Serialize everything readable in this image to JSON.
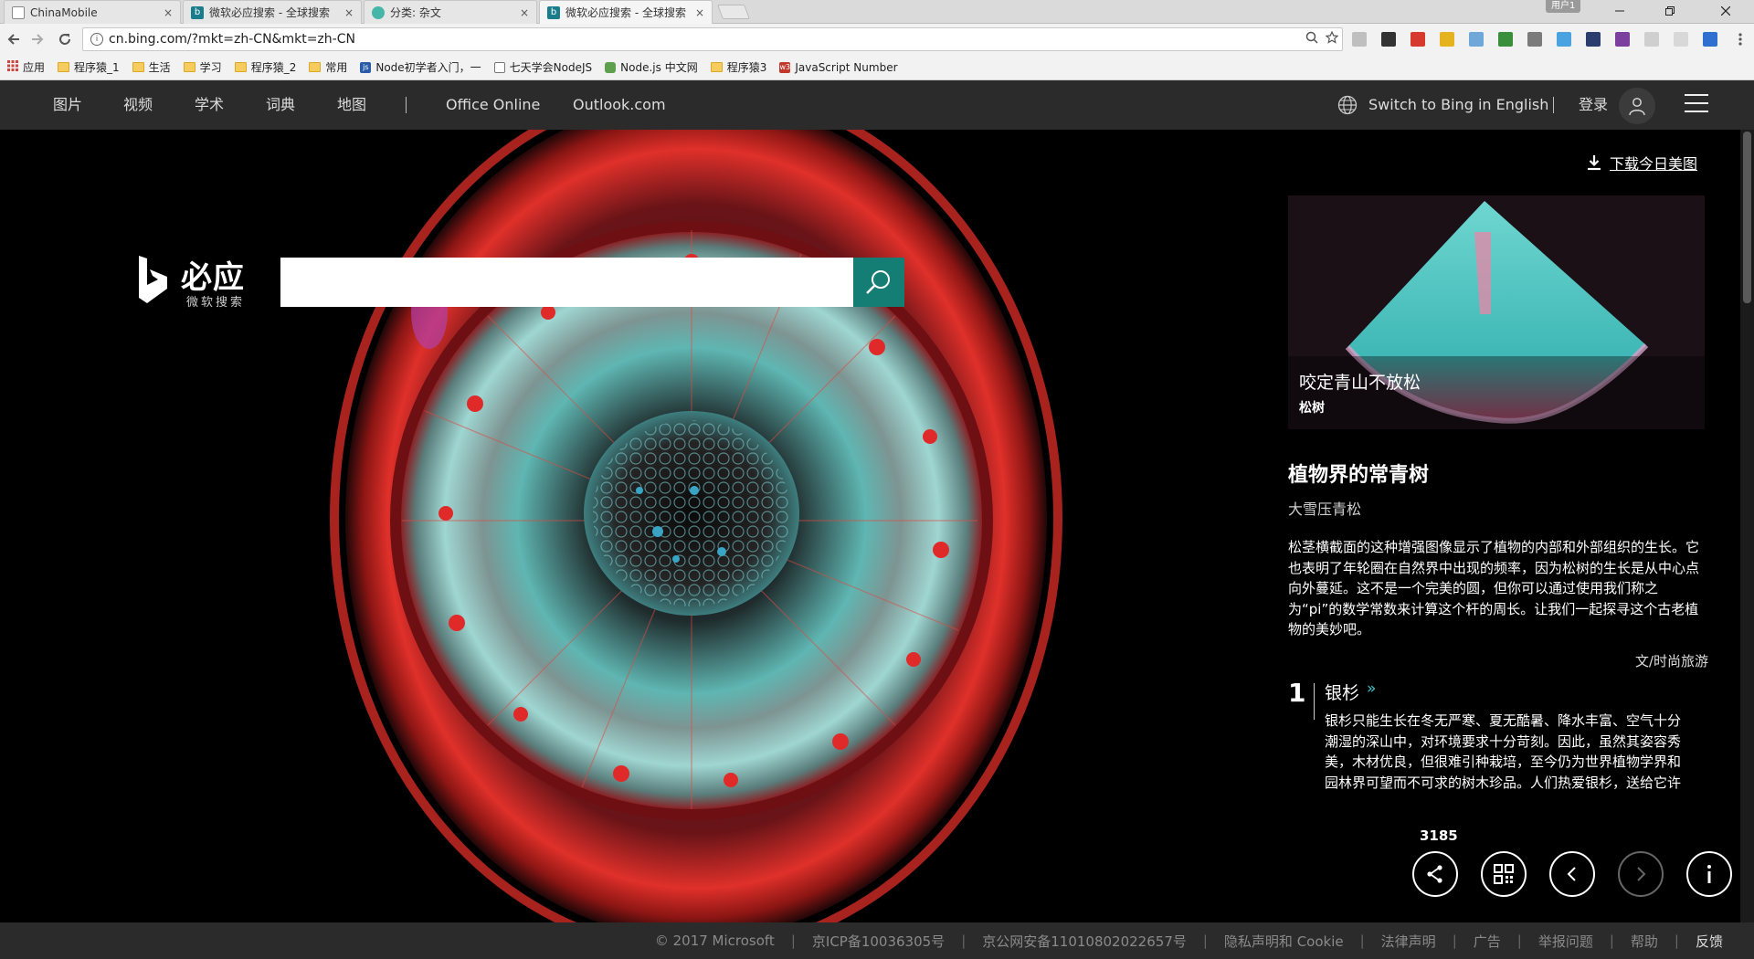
{
  "browser": {
    "tabs": [
      {
        "title": "ChinaMobile",
        "favicon": "page-icon",
        "active": false
      },
      {
        "title": "微软必应搜索 - 全球搜索",
        "favicon": "bing-icon",
        "active": false
      },
      {
        "title": "分类: 杂文",
        "favicon": "globe-icon",
        "active": false
      },
      {
        "title": "微软必应搜索 - 全球搜索",
        "favicon": "bing-icon",
        "active": true
      }
    ],
    "close_glyph": "×",
    "user_label": "用户1",
    "window_controls": [
      "minimize",
      "restore",
      "close"
    ],
    "url": "cn.bing.com/?mkt=zh-CN&mkt=zh-CN",
    "bookmarks": [
      {
        "label": "应用",
        "icon": "apps-grid-icon"
      },
      {
        "label": "程序猿_1",
        "icon": "folder-icon"
      },
      {
        "label": "生活",
        "icon": "folder-icon"
      },
      {
        "label": "学习",
        "icon": "folder-icon"
      },
      {
        "label": "程序猿_2",
        "icon": "folder-icon"
      },
      {
        "label": "常用",
        "icon": "folder-icon"
      },
      {
        "label": "Node初学者入门，一",
        "icon": "site-icon"
      },
      {
        "label": "七天学会NodeJS",
        "icon": "page-icon"
      },
      {
        "label": "Node.js 中文网",
        "icon": "node-icon"
      },
      {
        "label": "程序猿3",
        "icon": "folder-icon"
      },
      {
        "label": "JavaScript Number",
        "icon": "w3-icon"
      }
    ]
  },
  "bing": {
    "nav": [
      "图片",
      "视频",
      "学术",
      "词典",
      "地图"
    ],
    "nav_external": [
      "Office Online",
      "Outlook.com"
    ],
    "switch_lang": "Switch to Bing in English",
    "login": "登录",
    "logo_text": "必应",
    "logo_sub": "微软搜索",
    "search_placeholder": "",
    "download_label": "下载今日美图",
    "card": {
      "title": "咬定青山不放松",
      "subtitle": "松树"
    },
    "article": {
      "title": "植物界的常青树",
      "subtitle": "大雪压青松",
      "body": "松茎横截面的这种增强图像显示了植物的内部和外部组织的生长。它也表明了年轮圈在自然界中出现的频率，因为松树的生长是从中心点向外蔓延。这不是一个完美的圆，但你可以通过使用我们称之为“pi”的数学常数来计算这个杆的周长。让我们一起探寻这个古老植物的美妙吧。",
      "author": "文/时尚旅游"
    },
    "list_item": {
      "number": "1",
      "name": "银杉",
      "chevron": "»",
      "description": "银杉只能生长在冬无严寒、夏无酷暑、降水丰富、空气十分潮湿的深山中，对环境要求十分苛刻。因此，虽然其姿容秀美，木材优良，但很难引种栽培，至今仍为世界植物学界和园林界可望而不可求的树木珍品。人们热爱银杉，送给它许多动人的名称：“活化石”"
    },
    "view_count": "3185",
    "footer": [
      "© 2017 Microsoft",
      "京ICP备10036305号",
      "京公网安备11010802022657号",
      "隐私声明和 Cookie",
      "法律声明",
      "广告",
      "举报问题",
      "帮助",
      "反馈"
    ],
    "colors": {
      "accent": "#147d74",
      "header_bg": "#2b2b2b"
    }
  }
}
